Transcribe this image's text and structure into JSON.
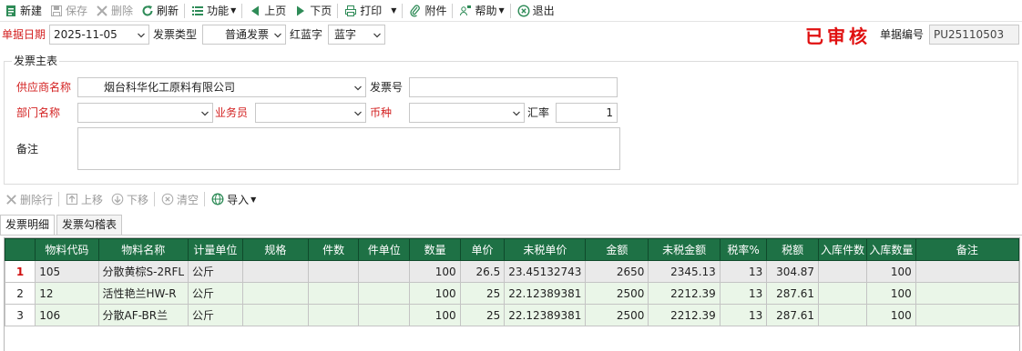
{
  "toolbar": {
    "new": "新建",
    "save": "保存",
    "delete": "删除",
    "refresh": "刷新",
    "function": "功能",
    "prev": "上页",
    "next": "下页",
    "print": "打印",
    "attachment": "附件",
    "help": "帮助",
    "exit": "退出"
  },
  "header": {
    "date_label": "单据日期",
    "date_value": "2025-11-05",
    "invoice_type_label": "发票类型",
    "invoice_type_value": "普通发票",
    "red_blue_label": "红蓝字",
    "red_blue_value": "蓝字",
    "status_stamp": "已审核",
    "doc_no_label": "单据编号",
    "doc_no_value": "PU25110503"
  },
  "main": {
    "group_title": "发票主表",
    "supplier_label": "供应商名称",
    "supplier_value": "烟台科华化工原料有限公司",
    "invoice_no_label": "发票号",
    "invoice_no_value": "",
    "dept_label": "部门名称",
    "dept_value": "",
    "salesman_label": "业务员",
    "salesman_value": "",
    "currency_label": "币种",
    "currency_value": "",
    "rate_label": "汇率",
    "rate_value": "1",
    "remark_label": "备注",
    "remark_value": ""
  },
  "grid_toolbar": {
    "delete_row": "删除行",
    "move_up": "上移",
    "move_down": "下移",
    "clear": "清空",
    "import": "导入"
  },
  "tabs": [
    "发票明细",
    "发票勾稽表"
  ],
  "grid": {
    "columns": [
      "",
      "物料代码",
      "物料名称",
      "计量单位",
      "规格",
      "件数",
      "件单位",
      "数量",
      "单价",
      "未税单价",
      "金额",
      "未税金额",
      "税率%",
      "税额",
      "入库件数",
      "入库数量",
      "备注"
    ],
    "rows": [
      [
        "1",
        "105",
        "分散黄棕S-2RFL",
        "公斤",
        "",
        "",
        "",
        "100",
        "26.5",
        "23.45132743",
        "2650",
        "2345.13",
        "13",
        "304.87",
        "",
        "100",
        ""
      ],
      [
        "2",
        "12",
        "活性艳兰HW-R",
        "公斤",
        "",
        "",
        "",
        "100",
        "25",
        "22.12389381",
        "2500",
        "2212.39",
        "13",
        "287.61",
        "",
        "100",
        ""
      ],
      [
        "3",
        "106",
        "分散AF-BR兰",
        "公斤",
        "",
        "",
        "",
        "100",
        "25",
        "22.12389381",
        "2500",
        "2212.39",
        "13",
        "287.61",
        "",
        "100",
        ""
      ]
    ]
  },
  "colors": {
    "grid_header": "#1e7145",
    "label_red": "#d32020",
    "stamp_red": "#e01010",
    "row_green": "#eaf6e8"
  }
}
